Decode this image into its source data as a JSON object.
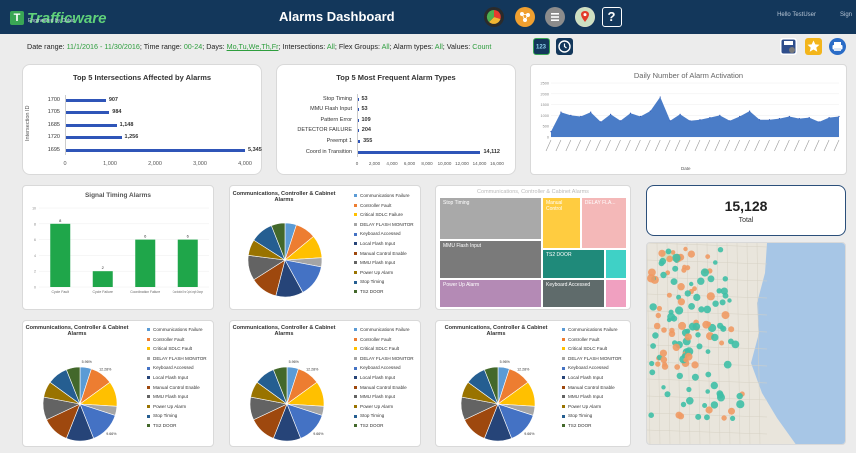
{
  "brand": {
    "name": "Trafficware",
    "sub": "Engineered by Cubic"
  },
  "title": "Alarms Dashboard",
  "user": {
    "greeting": "Hello TestUser",
    "sign": "Sign"
  },
  "nav_icons": [
    "pie-chart-icon",
    "traffic-network-icon",
    "list-icon",
    "map-pin-icon",
    "help-icon"
  ],
  "filters": {
    "date_label": "Date range:",
    "date_value": "11/1/2016 - 11/30/2016",
    "time_label": "Time range:",
    "time_value": "00-24",
    "days_label": "Days:",
    "days_value": "Mo,Tu,We,Th,Fr",
    "intersections_label": "Intersections:",
    "intersections_value": "All",
    "flex_label": "Flex Groups:",
    "flex_value": "All",
    "alarm_label": "Alarm types:",
    "alarm_value": "All",
    "values_label": "Values:",
    "values_value": "Count"
  },
  "toggle_labels": {
    "numeric": "123"
  },
  "colors": {
    "header": "#13375b",
    "accent_green": "#2e9e3e",
    "bar_blue": "#2f55b8",
    "bar_green": "#1fa64a"
  },
  "chart_data": [
    {
      "type": "bar",
      "orientation": "horizontal",
      "title": "Top 5 Intersections Affected by Alarms",
      "ylabel": "Intersection ID",
      "categories": [
        "1700",
        "1705",
        "1685",
        "1720",
        "1695"
      ],
      "values": [
        907,
        984,
        1148,
        1256,
        5345
      ],
      "value_labels": [
        "907",
        "984",
        "1,148",
        "1,256",
        "5,345"
      ],
      "xticks": [
        "0",
        "1,000",
        "2,000",
        "3,000",
        "4,000"
      ],
      "xlim": [
        0,
        4000
      ]
    },
    {
      "type": "bar",
      "orientation": "horizontal",
      "title": "Top 5 Most Frequent Alarm Types",
      "categories": [
        "Stop Timing",
        "MMU Flash Input",
        "Pattern Error",
        "DETECTOR FAILURE",
        "Preempt 1",
        "Coord in Transition"
      ],
      "values": [
        53,
        53,
        109,
        204,
        355,
        14112
      ],
      "value_labels": [
        "53",
        "53",
        "109",
        "204",
        "355",
        "14,112"
      ],
      "xticks": [
        "0",
        "2,000",
        "4,000",
        "6,000",
        "8,000",
        "10,000",
        "12,000",
        "14,000",
        "16,000"
      ],
      "xlim": [
        0,
        16000
      ]
    },
    {
      "type": "area",
      "title": "Daily Number of Alarm Activation",
      "xlabel": "Date",
      "yticks": [
        "2500",
        "2000",
        "1500",
        "1000",
        "500",
        "0"
      ],
      "ylim": [
        0,
        2500
      ],
      "values": [
        250,
        1150,
        1000,
        950,
        1150,
        700,
        1050,
        750,
        1100,
        950,
        1200,
        1850,
        750,
        1050,
        750,
        800,
        900,
        1000,
        750,
        950,
        1200,
        800,
        800,
        850,
        950,
        850,
        900,
        700,
        900,
        950
      ]
    },
    {
      "type": "bar",
      "title": "Signal Timing Alarms",
      "categories": [
        "Cycle Fault",
        "Cycle Failure",
        "Coordination Failure",
        "Coordination Error Cycle Length Change"
      ],
      "values": [
        8,
        2,
        6,
        6
      ],
      "value_labels": [
        "8",
        "2",
        "6",
        "6"
      ],
      "yticks": [
        "10",
        "8",
        "6",
        "4",
        "2",
        "0"
      ],
      "ylim": [
        0,
        10
      ]
    },
    {
      "type": "pie",
      "title": "Communications, Controller & Cabinet Alarms",
      "legend": [
        "Communications Failure",
        "Controller Fault",
        "Critical SDLC Failure",
        "DELAY FLASH MONITOR",
        "Keyboard Accessed",
        "Local Flash Input",
        "Manual Control Enable",
        "MMU Flash Input",
        "Power Up Alarm",
        "Stop Timing",
        "TS2 DOOR"
      ],
      "values": [
        5,
        9,
        10,
        4,
        14,
        12,
        12,
        11,
        7,
        10,
        6
      ],
      "slice_labels": [
        "",
        "",
        "",
        "",
        "",
        "",
        "",
        "",
        "",
        "",
        ""
      ]
    },
    {
      "type": "treemap",
      "title": "Communications, Controller & Cabinet Alarms",
      "cells": [
        {
          "label": "Stop Timing",
          "value": 9
        },
        {
          "label": "MMU Flash Input",
          "value": 8
        },
        {
          "label": "Power Up Alarm",
          "value": 6
        },
        {
          "label": "Manual Control",
          "value": 6
        },
        {
          "label": "TS2 DOOR",
          "value": 4
        },
        {
          "label": "Keyboard Accessed",
          "value": 4
        },
        {
          "label": "DELAY FLA...",
          "value": 3
        },
        {
          "label": "",
          "value": 1
        },
        {
          "label": "",
          "value": 1
        }
      ]
    },
    {
      "type": "pie",
      "title": "Communications, Controller & Cabinet Alarms",
      "legend": [
        "Communications Failure",
        "Controller Fault",
        "Critical SDLC Fault",
        "DELAY FLASH MONITOR",
        "Keyboard Accessed",
        "Local Flash Input",
        "Manual Control Enable",
        "MMU Flash Input",
        "Power Up Alarm",
        "Stop Timing",
        "TS2 DOOR"
      ],
      "values": [
        5,
        10,
        11,
        4,
        14,
        12,
        12,
        10,
        7,
        9,
        6
      ],
      "slice_labels": [
        "5.96%",
        "12.28%",
        "",
        "",
        "9.66%",
        "",
        "",
        "",
        "",
        "",
        ""
      ]
    },
    {
      "type": "pie",
      "title": "Communications, Controller & Cabinet Alarms",
      "legend": [
        "Communications Failure",
        "Controller Fault",
        "Critical SDLC Fault",
        "DELAY FLASH MONITOR",
        "Keyboard Accessed",
        "Local Flash Input",
        "Manual Control Enable",
        "MMU Flash Input",
        "Power Up Alarm",
        "Stop Timing",
        "TS2 DOOR"
      ],
      "values": [
        5,
        10,
        11,
        4,
        14,
        12,
        12,
        10,
        7,
        9,
        6
      ],
      "slice_labels": [
        "5.96%",
        "12.28%",
        "",
        "",
        "9.66%",
        "",
        "",
        "",
        "",
        "",
        ""
      ]
    },
    {
      "type": "pie",
      "title": "Communications, Controller & Cabinet Alarms",
      "legend": [
        "Communications Failure",
        "Controller Fault",
        "Critical SDLC Fault",
        "DELAY FLASH MONITOR",
        "Keyboard Accessed",
        "Local Flash Input",
        "Manual Control Enable",
        "MMU Flash Input",
        "Power Up Alarm",
        "Stop Timing",
        "TS2 DOOR"
      ],
      "values": [
        5,
        10,
        11,
        4,
        14,
        12,
        12,
        10,
        7,
        9,
        6
      ],
      "slice_labels": [
        "5.96%",
        "12.28%",
        "",
        "",
        "9.66%",
        "",
        "",
        "",
        "",
        "",
        ""
      ]
    }
  ],
  "pie_colors": [
    "#5b9bd5",
    "#ed7d31",
    "#ffc000",
    "#a5a5a5",
    "#4472c4",
    "#264478",
    "#9e480e",
    "#636363",
    "#997300",
    "#255e91",
    "#43682b"
  ],
  "treemap_colors": [
    "#a9a9a9",
    "#7a7a7a",
    "#b48ab5",
    "#ffcc40",
    "#1f8a7a",
    "#5f6b6b",
    "#f4b8b8",
    "#3fd1c6",
    "#f0a0c0"
  ],
  "total": {
    "value": "15,128",
    "label": "Total"
  },
  "map": {
    "clusters": 140
  }
}
